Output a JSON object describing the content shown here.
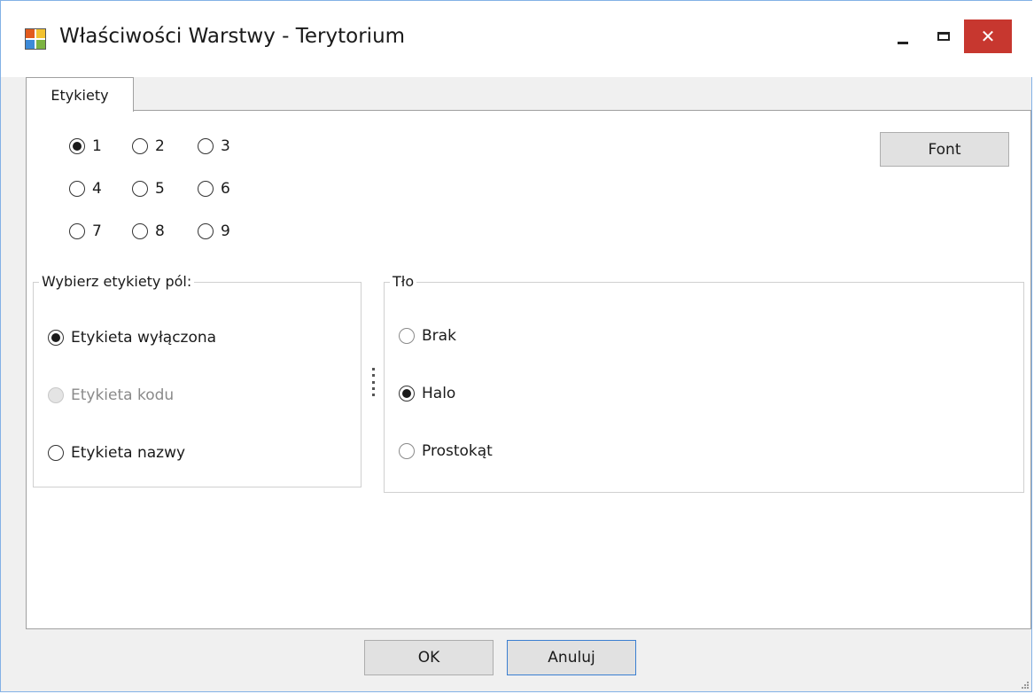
{
  "window": {
    "title": "Właściwości Warstwy - Terytorium",
    "icon": "layer-properties-app-icon",
    "controls": [
      "minimize-icon",
      "maximize-icon",
      "close-icon"
    ],
    "close_glyph": "✕",
    "close_color": "#c7372f"
  },
  "tabs": [
    {
      "label": "Etykiety",
      "selected": true
    }
  ],
  "position_grid": {
    "options": [
      "1",
      "2",
      "3",
      "4",
      "5",
      "6",
      "7",
      "8",
      "9"
    ],
    "selected": "1"
  },
  "font_button": {
    "label": "Font"
  },
  "field_labels": {
    "legend": "Wybierz etykiety pól:",
    "options": [
      {
        "label": "Etykieta wyłączona",
        "checked": true,
        "enabled": true
      },
      {
        "label": "Etykieta kodu",
        "checked": false,
        "enabled": false
      },
      {
        "label": "Etykieta nazwy",
        "checked": false,
        "enabled": true
      }
    ]
  },
  "background": {
    "legend": "Tło",
    "options": [
      {
        "label": "Brak",
        "checked": false
      },
      {
        "label": "Halo",
        "checked": true
      },
      {
        "label": "Prostokąt",
        "checked": false
      }
    ]
  },
  "buttons": {
    "ok": "OK",
    "cancel": "Anuluj"
  },
  "colors": {
    "accent_border": "#3b7fd1",
    "window_border": "#83b1e6"
  }
}
